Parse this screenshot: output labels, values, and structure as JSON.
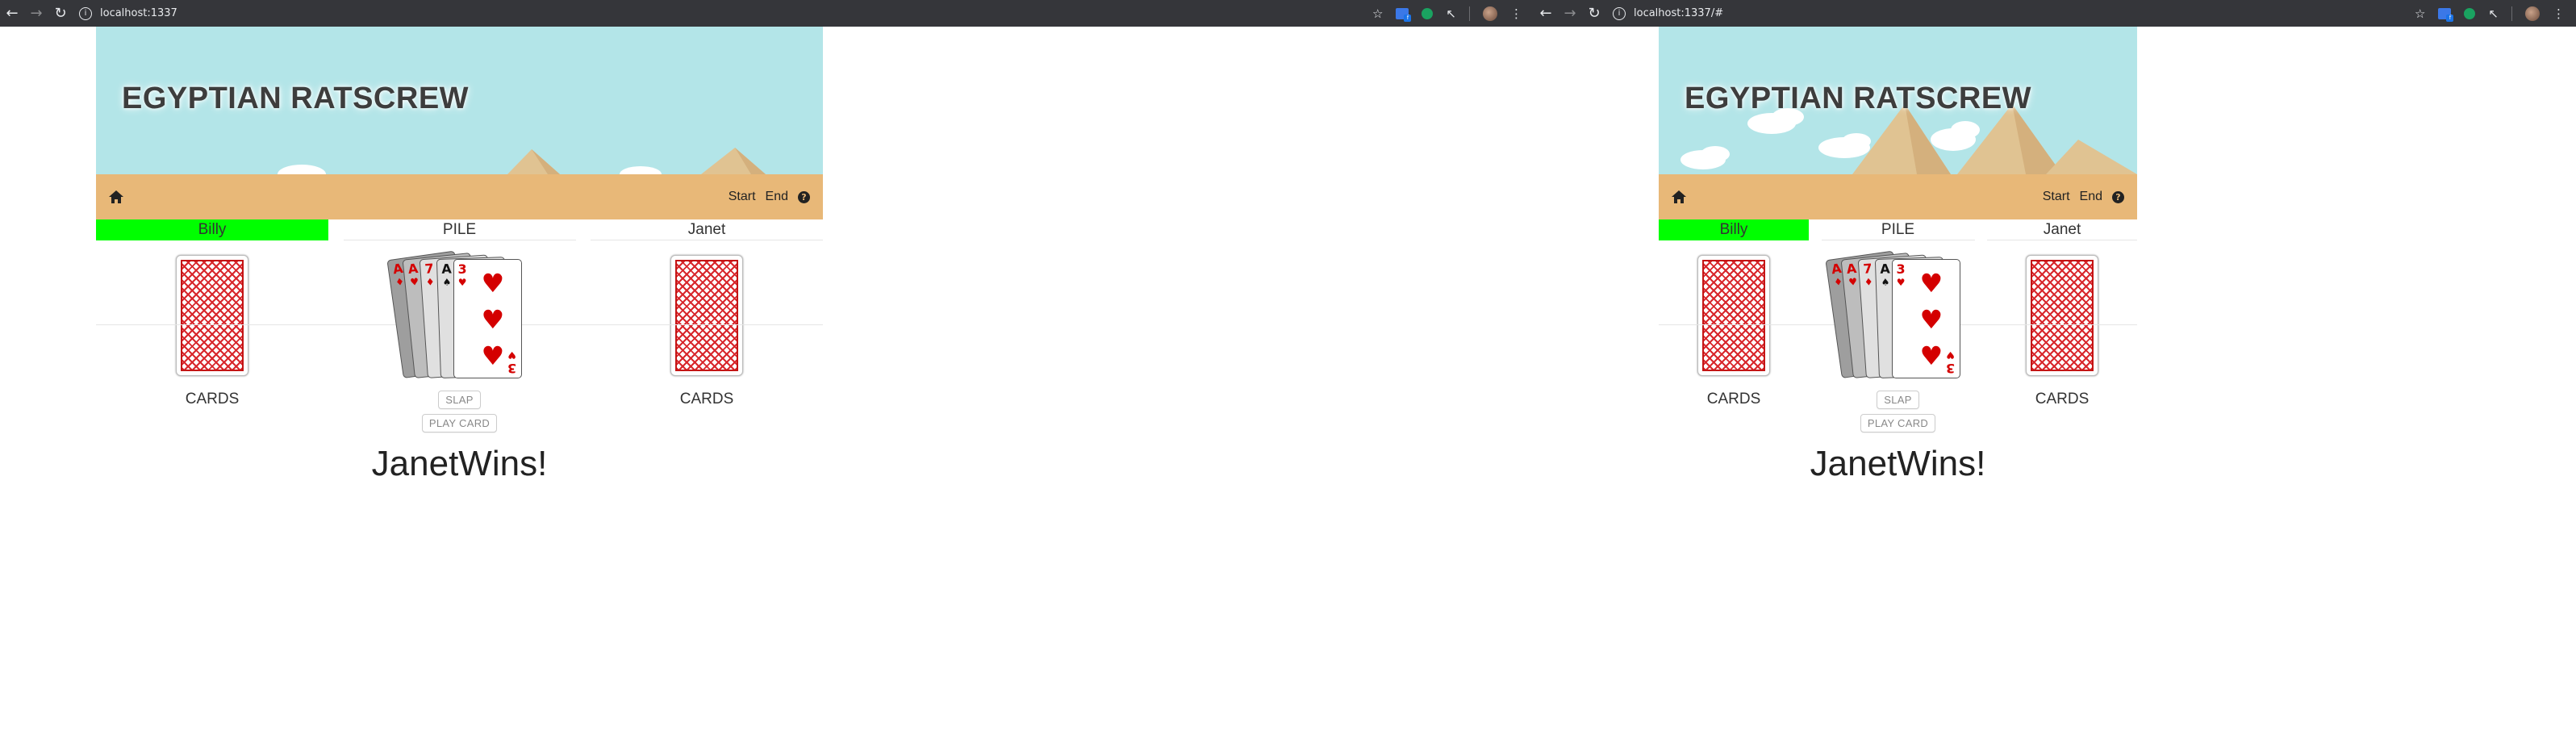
{
  "windows": [
    {
      "url": "localhost:1337",
      "app": {
        "title": "EGYPTIAN RATSCREW",
        "nav": {
          "start": "Start",
          "end": "End",
          "help": "?"
        },
        "players": {
          "left": "Billy",
          "pile": "PILE",
          "right": "Janet"
        },
        "cards_label": "CARDS",
        "slap_button": "SLAP",
        "play_card_button": "PLAY CARD",
        "winner_text": "JanetWins!"
      }
    },
    {
      "url": "localhost:1337/#",
      "app": {
        "title": "EGYPTIAN RATSCREW",
        "nav": {
          "start": "Start",
          "end": "End",
          "help": "?"
        },
        "players": {
          "left": "Billy",
          "pile": "PILE",
          "right": "Janet"
        },
        "cards_label": "CARDS",
        "slap_button": "SLAP",
        "play_card_button": "PLAY CARD",
        "winner_text": "JanetWins!"
      }
    }
  ],
  "pile_cards": [
    {
      "rank": "A",
      "suit": "♦",
      "color": "red"
    },
    {
      "rank": "A",
      "suit": "♥",
      "color": "red"
    },
    {
      "rank": "7",
      "suit": "♦",
      "color": "red"
    },
    {
      "rank": "A",
      "suit": "♠",
      "color": "black"
    },
    {
      "rank": "3",
      "suit": "♥",
      "color": "red"
    }
  ],
  "colors": {
    "active_player": "#00ff00",
    "navbar": "#e8b878",
    "sky": "#b3e5e8",
    "card_back": "#d8262b"
  },
  "icons": {
    "back": "arrow-left-icon",
    "forward": "arrow-right-icon",
    "reload": "reload-icon",
    "info": "info-icon",
    "star": "star-icon",
    "home": "home-icon",
    "help": "question-circle-icon",
    "menu": "kebab-menu-icon"
  }
}
